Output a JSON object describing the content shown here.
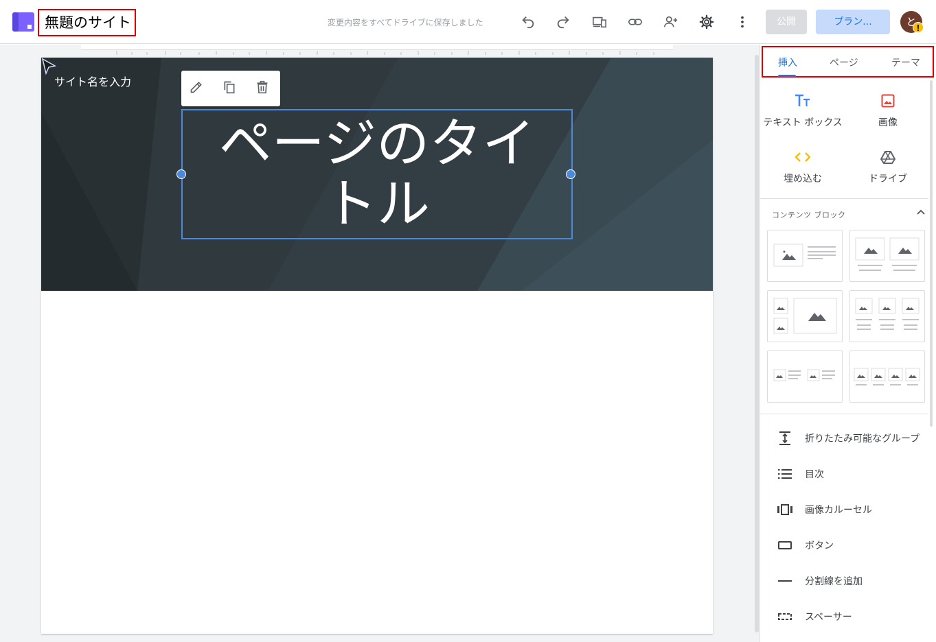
{
  "header": {
    "site_title": "無題のサイト",
    "saved_status": "変更内容をすべてドライブに保存しました",
    "publish_label": "公開",
    "plan_label": "プラン...",
    "avatar_initial": "と",
    "avatar_warning": "!"
  },
  "page": {
    "site_name": "サイト名を入力",
    "title_line1": "ページのタイ",
    "title_line2": "トル"
  },
  "panel": {
    "tabs": [
      {
        "label": "挿入",
        "active": true
      },
      {
        "label": "ページ",
        "active": false
      },
      {
        "label": "テーマ",
        "active": false
      }
    ],
    "insert_items": [
      {
        "label": "テキスト ボックス",
        "icon": "text-box-icon"
      },
      {
        "label": "画像",
        "icon": "image-icon"
      },
      {
        "label": "埋め込む",
        "icon": "embed-icon"
      },
      {
        "label": "ドライブ",
        "icon": "drive-icon"
      }
    ],
    "content_blocks_title": "コンテンツ ブロック",
    "list_items": [
      {
        "label": "折りたたみ可能なグループ",
        "icon": "collapsible-group-icon"
      },
      {
        "label": "目次",
        "icon": "table-of-contents-icon"
      },
      {
        "label": "画像カルーセル",
        "icon": "image-carousel-icon"
      },
      {
        "label": "ボタン",
        "icon": "button-icon"
      },
      {
        "label": "分割線を追加",
        "icon": "divider-icon"
      },
      {
        "label": "スペーサー",
        "icon": "spacer-icon"
      }
    ]
  },
  "colors": {
    "accent": "#1a73e8",
    "highlight_border": "#e00000",
    "selection": "#4a89dc",
    "header_bg": "#2f3a40"
  }
}
